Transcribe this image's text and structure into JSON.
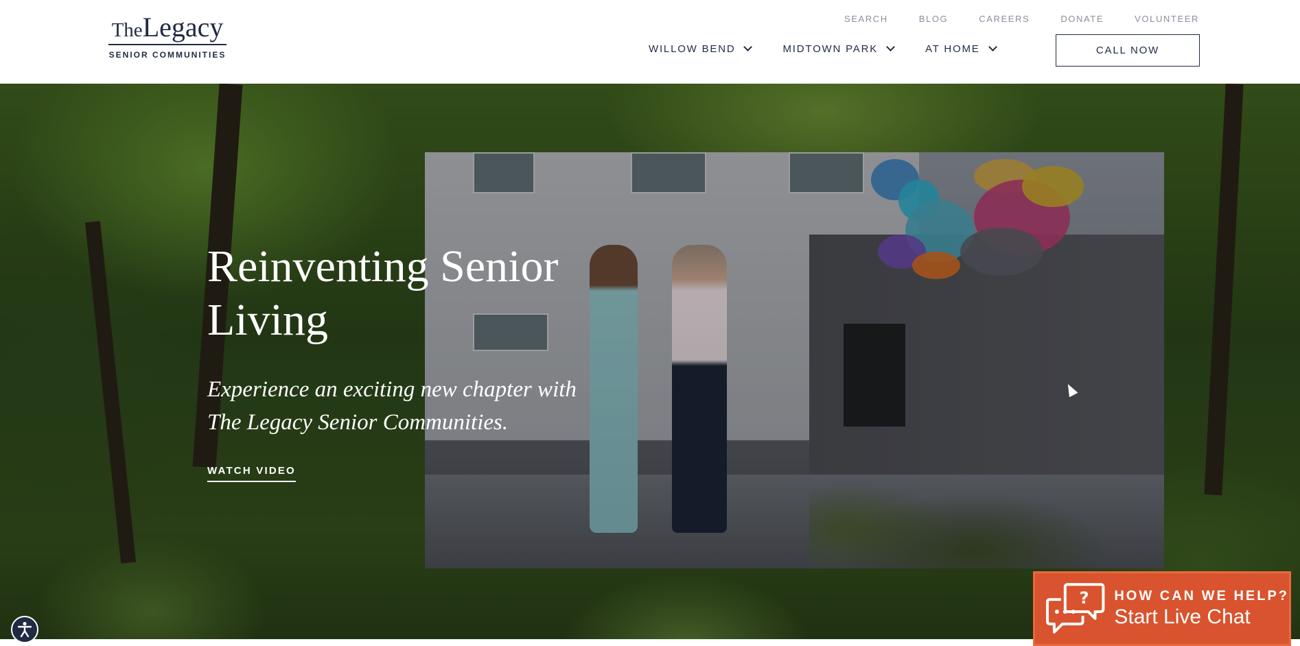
{
  "logo": {
    "the": "The",
    "legacy": "Legacy",
    "subtitle": "SENIOR COMMUNITIES"
  },
  "util_nav": [
    "SEARCH",
    "BLOG",
    "CAREERS",
    "DONATE",
    "VOLUNTEER"
  ],
  "main_nav": [
    "WILLOW BEND",
    "MIDTOWN PARK",
    "AT HOME"
  ],
  "call_button": "CALL NOW",
  "hero": {
    "title": "Reinventing Senior Living",
    "subtitle": "Experience an exciting new chapter with The Legacy Senior Communities.",
    "watch_video": "WATCH VIDEO"
  },
  "chat": {
    "question": "HOW CAN WE HELP?",
    "action": "Start Live Chat",
    "accent": "#d9532e"
  },
  "icons": [
    "chevron-down-icon",
    "accessibility-icon",
    "chat-bubbles-icon"
  ]
}
